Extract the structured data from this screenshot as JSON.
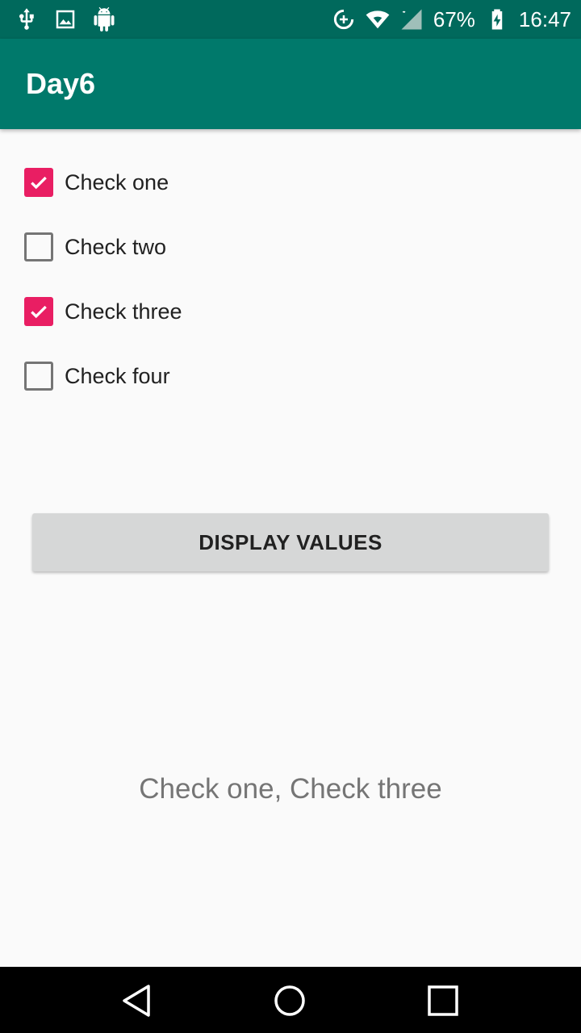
{
  "status_bar": {
    "battery": "67%",
    "time": "16:47",
    "icons_left": [
      "usb-icon",
      "image-icon",
      "android-debug-icon"
    ],
    "icons_right": [
      "data-saver-icon",
      "wifi-icon",
      "signal-icon",
      "battery-charging-icon"
    ]
  },
  "app_bar": {
    "title": "Day6"
  },
  "checkboxes": [
    {
      "label": "Check one",
      "checked": true
    },
    {
      "label": "Check two",
      "checked": false
    },
    {
      "label": "Check three",
      "checked": true
    },
    {
      "label": "Check four",
      "checked": false
    }
  ],
  "button": {
    "label": "DISPLAY VALUES"
  },
  "result": {
    "text": "Check one, Check three"
  },
  "nav_bar": {
    "icons": [
      "back-icon",
      "home-icon",
      "recents-icon"
    ]
  },
  "colors": {
    "status_bar": "#00695c",
    "app_bar": "#00796b",
    "checkbox_accent": "#e91e63",
    "button_bg": "#d6d7d7",
    "result_text": "#757575"
  }
}
